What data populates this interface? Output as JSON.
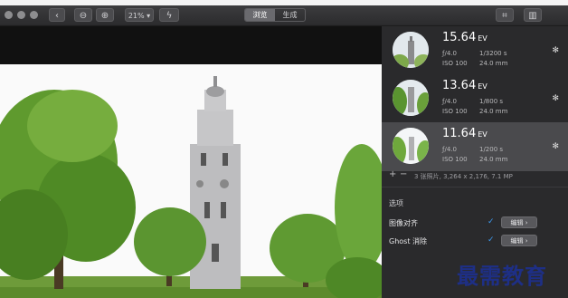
{
  "toolbar": {
    "zoom_out_icon": "zoom-out",
    "zoom_in_icon": "zoom-in",
    "zoom_value": "21%",
    "tabs": [
      "浏览",
      "生成"
    ],
    "active_tab": 0
  },
  "exposures": [
    {
      "ev": "15.64",
      "unit": "EV",
      "aperture": "ƒ/4.0",
      "shutter": "1/3200 s",
      "iso": "ISO 100",
      "focal": "24.0 mm",
      "selected": false
    },
    {
      "ev": "13.64",
      "unit": "EV",
      "aperture": "ƒ/4.0",
      "shutter": "1/800 s",
      "iso": "ISO 100",
      "focal": "24.0 mm",
      "selected": false
    },
    {
      "ev": "11.64",
      "unit": "EV",
      "aperture": "ƒ/4.0",
      "shutter": "1/200 s",
      "iso": "ISO 100",
      "focal": "24.0 mm",
      "selected": true
    }
  ],
  "summary": "3 张照片, 3,264 x 2,176, 7.1 MP",
  "options": {
    "title": "选项",
    "items": [
      {
        "label": "图像对齐",
        "checked": true,
        "button": "编辑"
      },
      {
        "label": "Ghost 消除",
        "checked": true,
        "button": "编辑"
      }
    ]
  },
  "watermark": "最需教育",
  "colors": {
    "panel": "#2a2a2c",
    "accent_check": "#3d9bf2"
  }
}
